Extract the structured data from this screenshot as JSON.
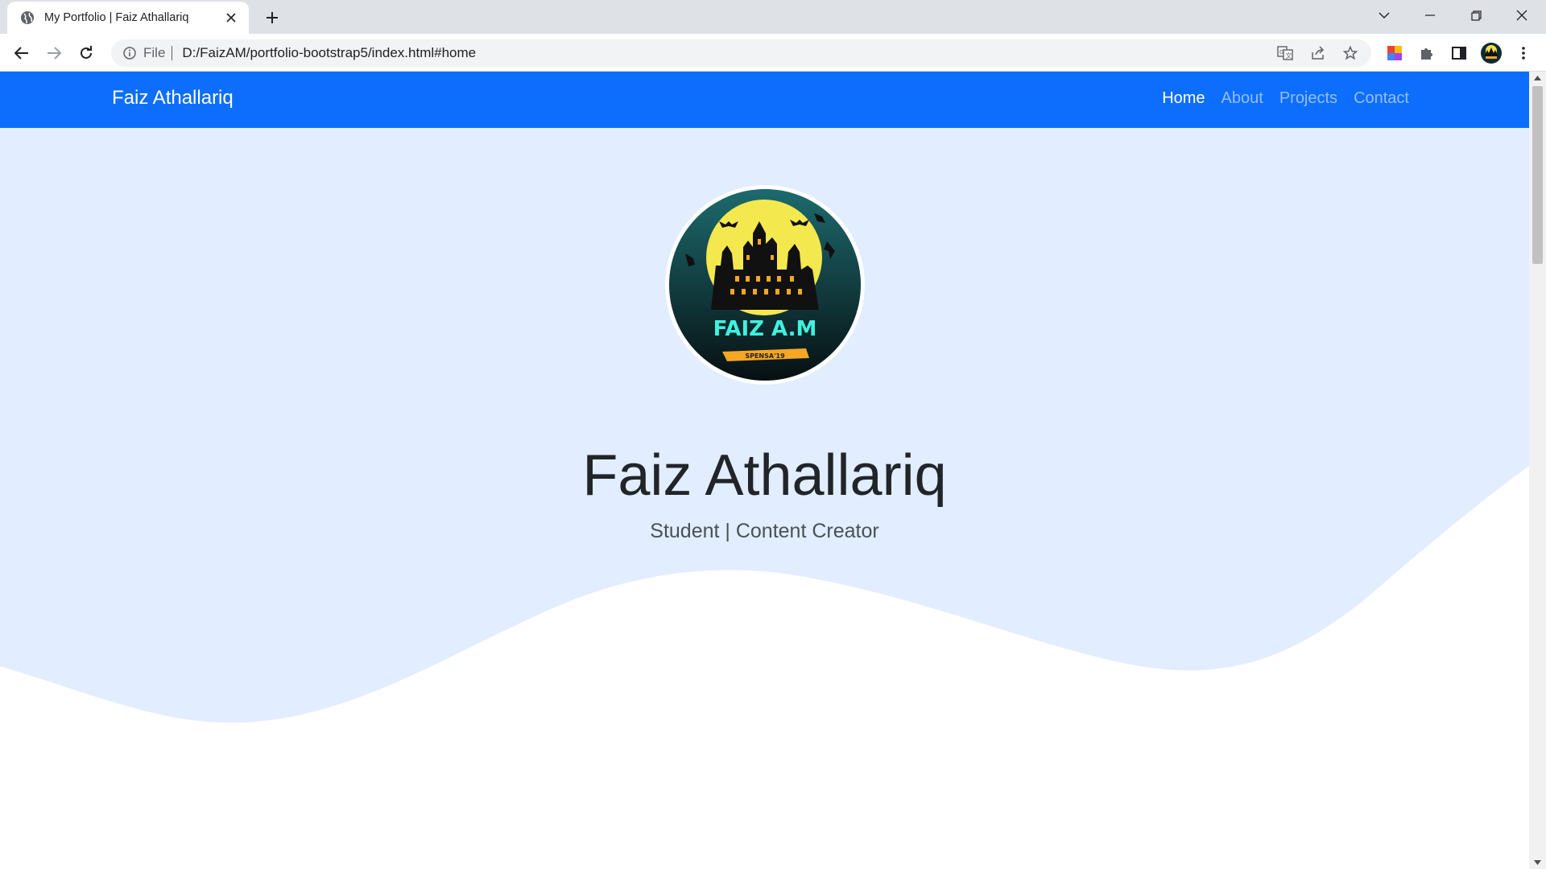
{
  "browser": {
    "tab_title": "My Portfolio | Faiz Athallariq",
    "omnibox_scheme": "File",
    "url": "D:/FaizAM/portfolio-bootstrap5/index.html#home"
  },
  "navbar": {
    "brand": "Faiz Athallariq",
    "links": [
      {
        "label": "Home",
        "active": true
      },
      {
        "label": "About",
        "active": false
      },
      {
        "label": "Projects",
        "active": false
      },
      {
        "label": "Contact",
        "active": false
      }
    ]
  },
  "hero": {
    "logo_text": "FAIZ A.M",
    "logo_banner": "SPENSA'19",
    "name": "Faiz Athallariq",
    "subtitle": "Student | Content Creator"
  },
  "colors": {
    "navbar": "#0d6efd",
    "hero_bg": "#e2edff",
    "wave": "#ffffff"
  },
  "icons": [
    "globe-icon",
    "close-icon",
    "plus-icon",
    "chevron-down-icon",
    "minimize-icon",
    "restore-icon",
    "window-close-icon",
    "back-icon",
    "forward-icon",
    "reload-icon",
    "info-icon",
    "translate-icon",
    "share-icon",
    "star-icon",
    "extension-color-icon",
    "puzzle-icon",
    "side-panel-icon",
    "profile-avatar-icon",
    "kebab-menu-icon"
  ]
}
